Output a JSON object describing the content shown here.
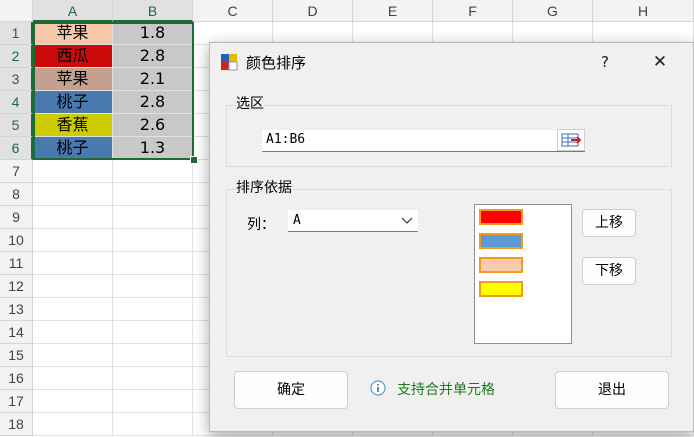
{
  "sheet": {
    "columns": [
      "A",
      "B",
      "C",
      "D",
      "E",
      "F",
      "G",
      "H"
    ],
    "rows": [
      "1",
      "2",
      "3",
      "4",
      "5",
      "6",
      "7",
      "8",
      "9",
      "10",
      "11",
      "12",
      "13",
      "14",
      "15",
      "16",
      "17",
      "18"
    ],
    "data": [
      {
        "a": "苹果",
        "b": "1.8",
        "color": "#f7c7a9"
      },
      {
        "a": "西瓜",
        "b": "2.8",
        "color": "#cc0a0a"
      },
      {
        "a": "苹果",
        "b": "2.1",
        "color": "#c4a090"
      },
      {
        "a": "桃子",
        "b": "2.8",
        "color": "#4a7aad"
      },
      {
        "a": "香蕉",
        "b": "2.6",
        "color": "#cccc00"
      },
      {
        "a": "桃子",
        "b": "1.3",
        "color": "#4a7aad"
      }
    ],
    "b_fill": "#c8c8c8",
    "selection_color": "#1d6b38"
  },
  "dialog": {
    "title": "颜色排序",
    "help": "?",
    "close": "✕",
    "selection_group": "选区",
    "range_value": "A1:B6",
    "sort_group": "排序依据",
    "column_label": "列：",
    "column_value": "A",
    "colors": [
      "#ff0000",
      "#5b9bd5",
      "#f8cbad",
      "#ffff00"
    ],
    "swatch_border": "#f39a1e",
    "move_up": "上移",
    "move_down": "下移",
    "ok": "确定",
    "info": "支持合并单元格",
    "exit": "退出"
  }
}
